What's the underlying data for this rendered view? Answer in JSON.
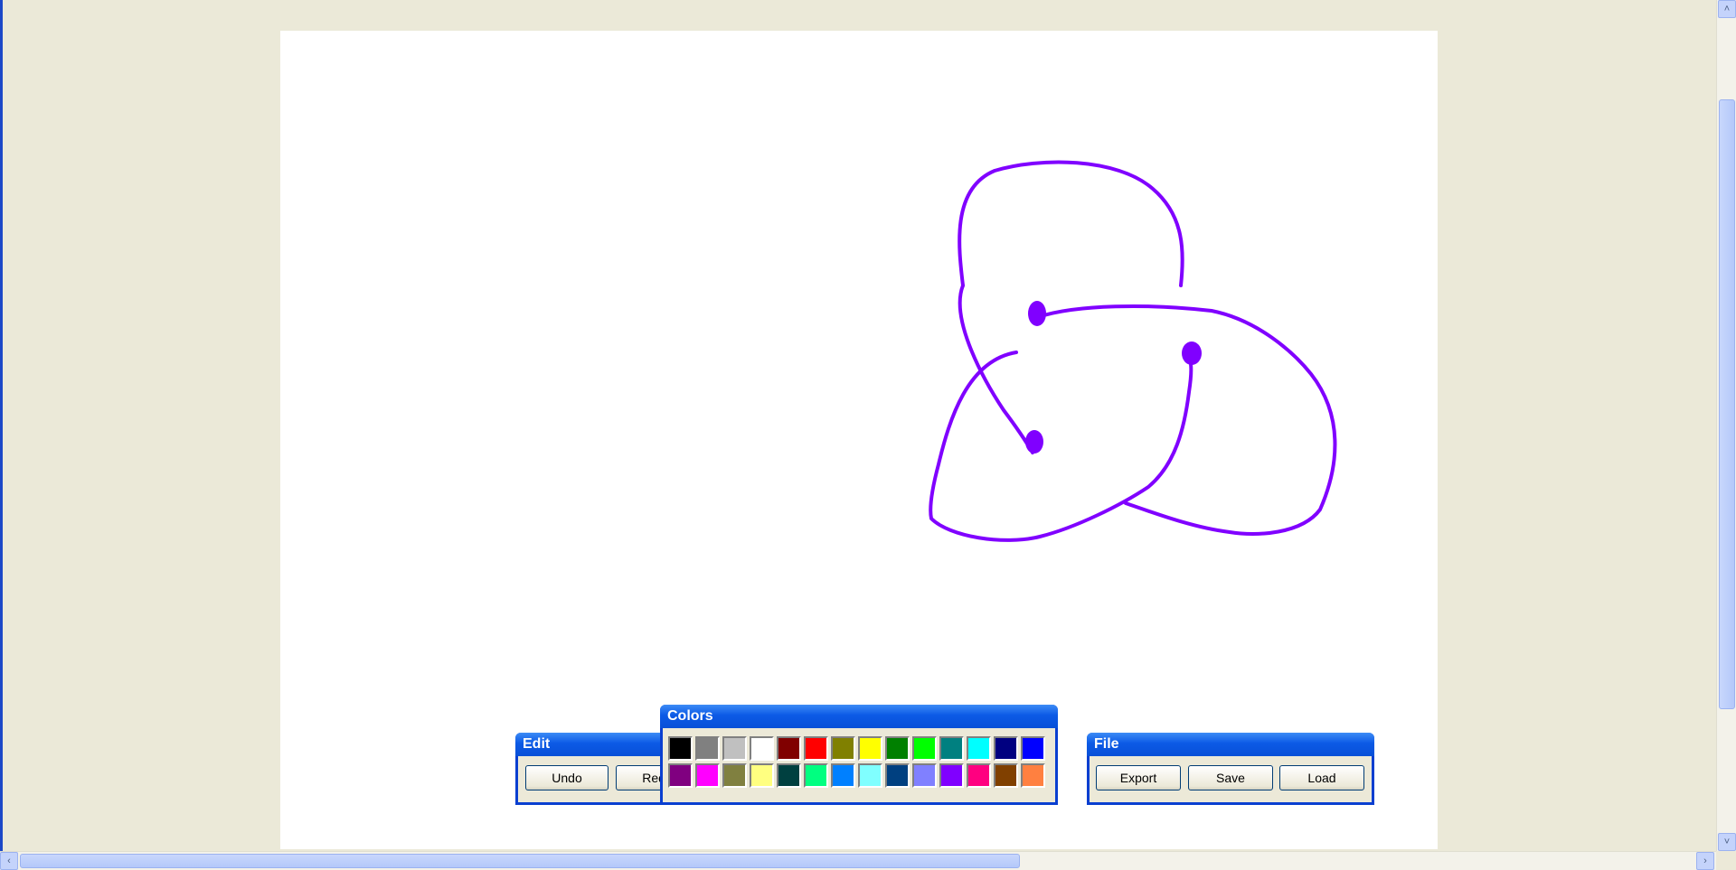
{
  "edit_toolbox": {
    "title": "Edit",
    "undo_label": "Undo",
    "redo_label": "Redo"
  },
  "colors_toolbox": {
    "title": "Colors",
    "palette": [
      "#000000",
      "#808080",
      "#c0c0c0",
      "#ffffff",
      "#800000",
      "#ff0000",
      "#808000",
      "#ffff00",
      "#008000",
      "#00ff00",
      "#008080",
      "#00ffff",
      "#000080",
      "#0000ff",
      "#800080",
      "#ff00ff",
      "#808040",
      "#ffff80",
      "#004040",
      "#00ff80",
      "#0080ff",
      "#80ffff",
      "#004080",
      "#8080ff",
      "#8000ff",
      "#ff0080",
      "#804000",
      "#ff8040"
    ]
  },
  "file_toolbox": {
    "title": "File",
    "export_label": "Export",
    "save_label": "Save",
    "load_label": "Load"
  },
  "drawing": {
    "stroke_color": "#8000ff",
    "subject": "hand-drawn trefoil knot"
  },
  "scrollbars": {
    "up_arrow": "˄",
    "down_arrow": "˅",
    "left_arrow": "‹",
    "right_arrow": "›"
  }
}
